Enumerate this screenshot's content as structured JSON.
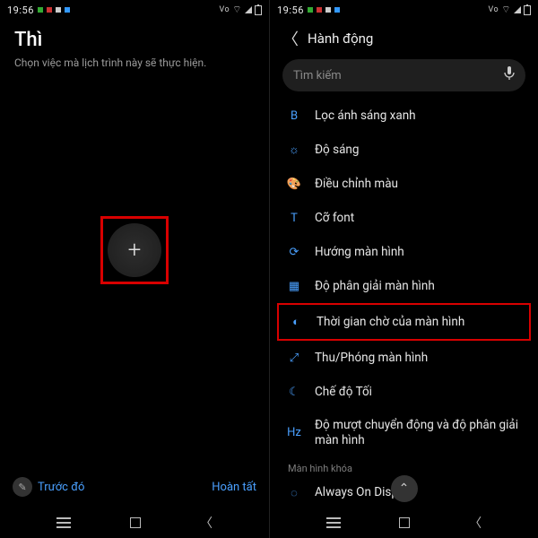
{
  "status": {
    "time": "19:56",
    "right_icons": [
      "vowifi",
      "wifi",
      "signal",
      "battery"
    ]
  },
  "left": {
    "title": "Thì",
    "subtitle": "Chọn việc mà lịch trình này sẽ thực hiện.",
    "fab_label": "+",
    "prev": "Trước đó",
    "done": "Hoàn tất"
  },
  "right": {
    "title": "Hành động",
    "search_placeholder": "Tìm kiếm",
    "items": [
      {
        "icon": "B",
        "label": "Lọc ánh sáng xanh"
      },
      {
        "icon": "☼",
        "label": "Độ sáng"
      },
      {
        "icon": "🎨",
        "label": "Điều chỉnh màu"
      },
      {
        "icon": "T",
        "label": "Cỡ font"
      },
      {
        "icon": "⟳",
        "label": "Hướng màn hình"
      },
      {
        "icon": "▦",
        "label": "Độ phân giải màn hình"
      },
      {
        "icon": "◐",
        "label": "Thời gian chờ của màn hình",
        "highlight": true
      },
      {
        "icon": "⤢",
        "label": "Thu/Phóng màn hình"
      },
      {
        "icon": "☾",
        "label": "Chế độ Tối"
      },
      {
        "icon": "Hz",
        "label": "Độ mượt chuyển động và độ phân giải màn hình"
      }
    ],
    "section_label": "Màn hình khóa",
    "aod_label": "Always On Display"
  }
}
